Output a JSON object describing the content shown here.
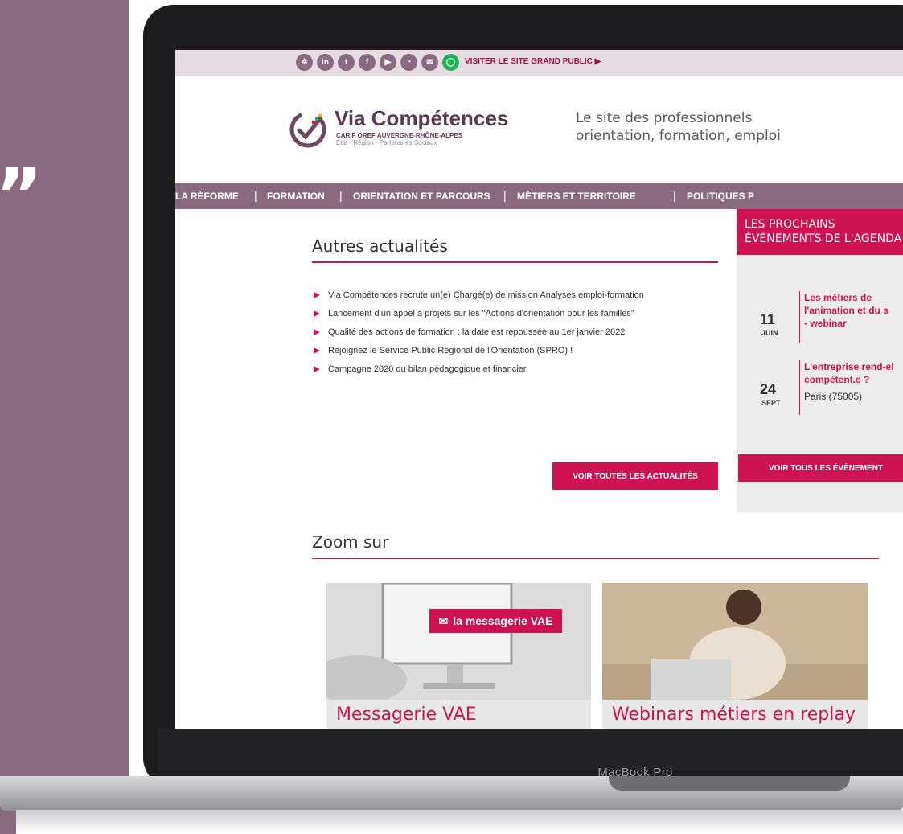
{
  "decor": {
    "quote": "„"
  },
  "device": {
    "brand": "MacBook Pro"
  },
  "topbar": {
    "social_icons": [
      "scoopit-icon",
      "linkedin-icon",
      "twitter-icon",
      "facebook-icon",
      "youtube-icon",
      "rss-icon",
      "mail-icon",
      "accessibility-icon"
    ],
    "visit_link": "VISITER LE SITE GRAND PUBLIC ▶"
  },
  "logo": {
    "name": "Via Compétences",
    "sub1": "CARIF OREF AUVERGNE-RHÔNE-ALPES",
    "sub2": "État - Région - Partenaires Sociaux"
  },
  "tagline": {
    "line1": "Le site des professionnels",
    "line2": "orientation, formation, emploi"
  },
  "nav": {
    "items": [
      "LA RÉFORME",
      "FORMATION",
      "ORIENTATION ET PARCOURS",
      "MÉTIERS ET TERRITOIRE",
      "POLITIQUES P"
    ]
  },
  "news": {
    "title": "Autres actualités",
    "items": [
      "Via Compétences recrute un(e) Chargé(e) de mission Analyses emploi-formation",
      "Lancement d'un appel à projets sur les \"Actions d'orientation pour les familles\"",
      "Qualité des actions de formation : la date est repoussée au 1er janvier 2022",
      "Rejoignez le Service Public Régional de l'Orientation (SPRO) !",
      "Campagne 2020 du bilan pédagogique et financier"
    ],
    "button": "VOIR TOUTES LES ACTUALITÉS"
  },
  "agenda": {
    "title_line1": "LES PROCHAINS",
    "title_line2": "ÉVÉNEMENTS DE L'AGENDA",
    "events": [
      {
        "day": "11",
        "month": "JUIN",
        "title_lines": [
          "Les métiers de",
          "l'animation et du s",
          "- webinar"
        ],
        "place": ""
      },
      {
        "day": "24",
        "month": "SEPT",
        "title_lines": [
          "L'entreprise rend-el",
          "compétent.e ?"
        ],
        "place": "Paris (75005)"
      }
    ],
    "button": "VOIR TOUS LES ÉVÈNEMENT"
  },
  "zoom": {
    "title": "Zoom sur",
    "cards": [
      {
        "label": "Messagerie VAE",
        "image_badge": "la messagerie VAE"
      },
      {
        "label": "Webinars métiers en replay"
      }
    ]
  },
  "colors": {
    "accent": "#cf1252",
    "brand_purple": "#8a6a7e"
  }
}
